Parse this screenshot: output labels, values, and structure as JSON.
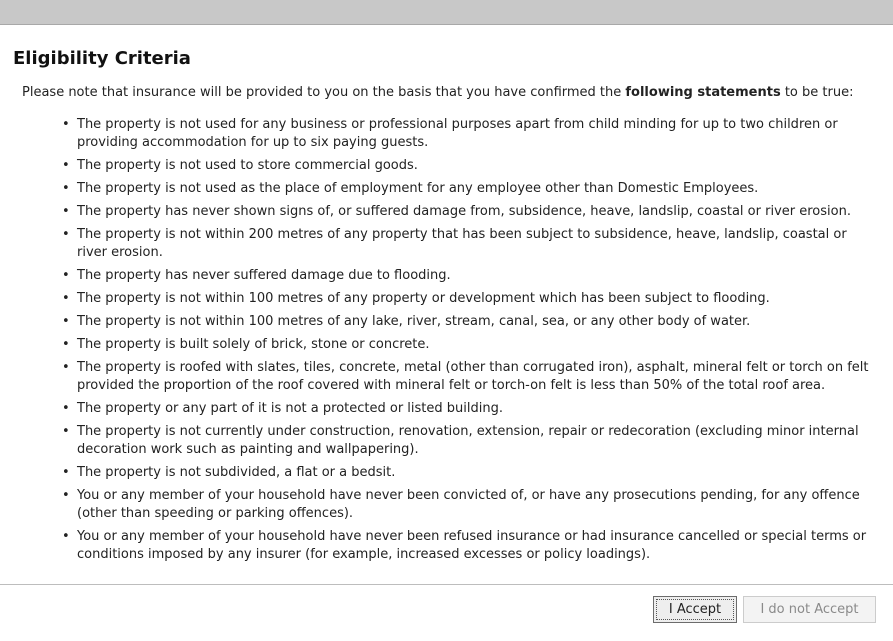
{
  "dialog": {
    "title": "Eligibility Criteria",
    "intro_prefix": "Please note that insurance will be provided to you on the basis that you have confirmed the ",
    "intro_bold": "following statements",
    "intro_suffix": " to be true:"
  },
  "criteria": [
    "The property is not used for any business or professional purposes apart from child minding for up to two children or providing accommodation for up to six paying guests.",
    "The property is not used to store commercial goods.",
    "The property is not used as the place of employment for any employee other than Domestic Employees.",
    "The property has never shown signs of, or suffered damage from, subsidence, heave, landslip, coastal or river erosion.",
    "The property is not within 200 metres of any property that has been subject to subsidence, heave, landslip, coastal or river erosion.",
    "The property has never suffered damage due to flooding.",
    "The property is not within 100 metres of any property or development which has been subject to flooding.",
    "The property is not within 100 metres of any lake, river, stream, canal, sea, or any other body of water.",
    "The property is built solely of brick, stone or concrete.",
    "The property is roofed with slates, tiles, concrete, metal (other than corrugated iron), asphalt, mineral felt or torch on felt provided the proportion of the roof covered with mineral felt or torch-on felt is less than 50% of the total roof area.",
    "The property or any part of it is not a protected or listed building.",
    "The property is not currently under construction, renovation, extension, repair or redecoration (excluding minor internal decoration work such as painting and wallpapering).",
    "The property is not subdivided, a flat or a bedsit.",
    "You or any member of your household have never been convicted of, or have any prosecutions pending, for any offence (other than speeding or parking offences).",
    "You or any member of your household have never been refused insurance or had insurance cancelled or special terms or conditions imposed by any insurer (for example, increased excesses or policy loadings)."
  ],
  "buttons": {
    "accept_label": "I Accept",
    "decline_label": "I do not Accept"
  }
}
